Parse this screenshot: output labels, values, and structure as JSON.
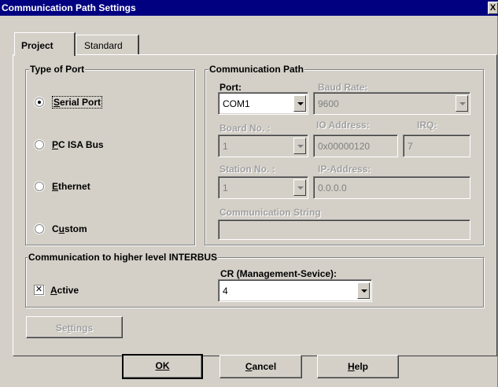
{
  "window": {
    "title": "Communication Path Settings",
    "close_glyph": "X"
  },
  "tabs": [
    {
      "label": "Project",
      "active": true
    },
    {
      "label": "Standard",
      "active": false
    }
  ],
  "type_of_port": {
    "legend": "Type of Port",
    "options": [
      {
        "pre": "",
        "u": "S",
        "post": "erial Port",
        "selected": true
      },
      {
        "pre": "",
        "u": "P",
        "post": "C ISA Bus",
        "selected": false
      },
      {
        "pre": "",
        "u": "E",
        "post": "thernet",
        "selected": false
      },
      {
        "pre": "C",
        "u": "u",
        "post": "stom",
        "selected": false
      }
    ]
  },
  "communication_path": {
    "legend": "Communication Path",
    "port_label": "Port:",
    "port_value": "COM1",
    "baud_label": "Baud Rate:",
    "baud_value": "9600",
    "board_label": "Board No. :",
    "board_value": "1",
    "io_label": "IO Address:",
    "io_value": "0x00000120",
    "irq_label": "IRQ:",
    "irq_value": "7",
    "station_label": "Station No. :",
    "station_value": "1",
    "ip_label": "IP-Address:",
    "ip_value": "0.0.0.0",
    "comm_string_label": "Communication String",
    "comm_string_value": ""
  },
  "higher_level": {
    "legend": "Communication to higher level INTERBUS",
    "active_pre": "",
    "active_u": "A",
    "active_post": "ctive",
    "active_checked": true,
    "check_glyph": "✕",
    "cr_label": "CR (Management-Sevice):",
    "cr_value": "4"
  },
  "settings_button": {
    "pre": "Se",
    "u": "t",
    "post": "tings"
  },
  "footer_buttons": {
    "ok": {
      "u": "O",
      "post": "K"
    },
    "cancel": {
      "u": "C",
      "post": "ancel"
    },
    "help": {
      "u": "H",
      "post": "elp"
    }
  }
}
